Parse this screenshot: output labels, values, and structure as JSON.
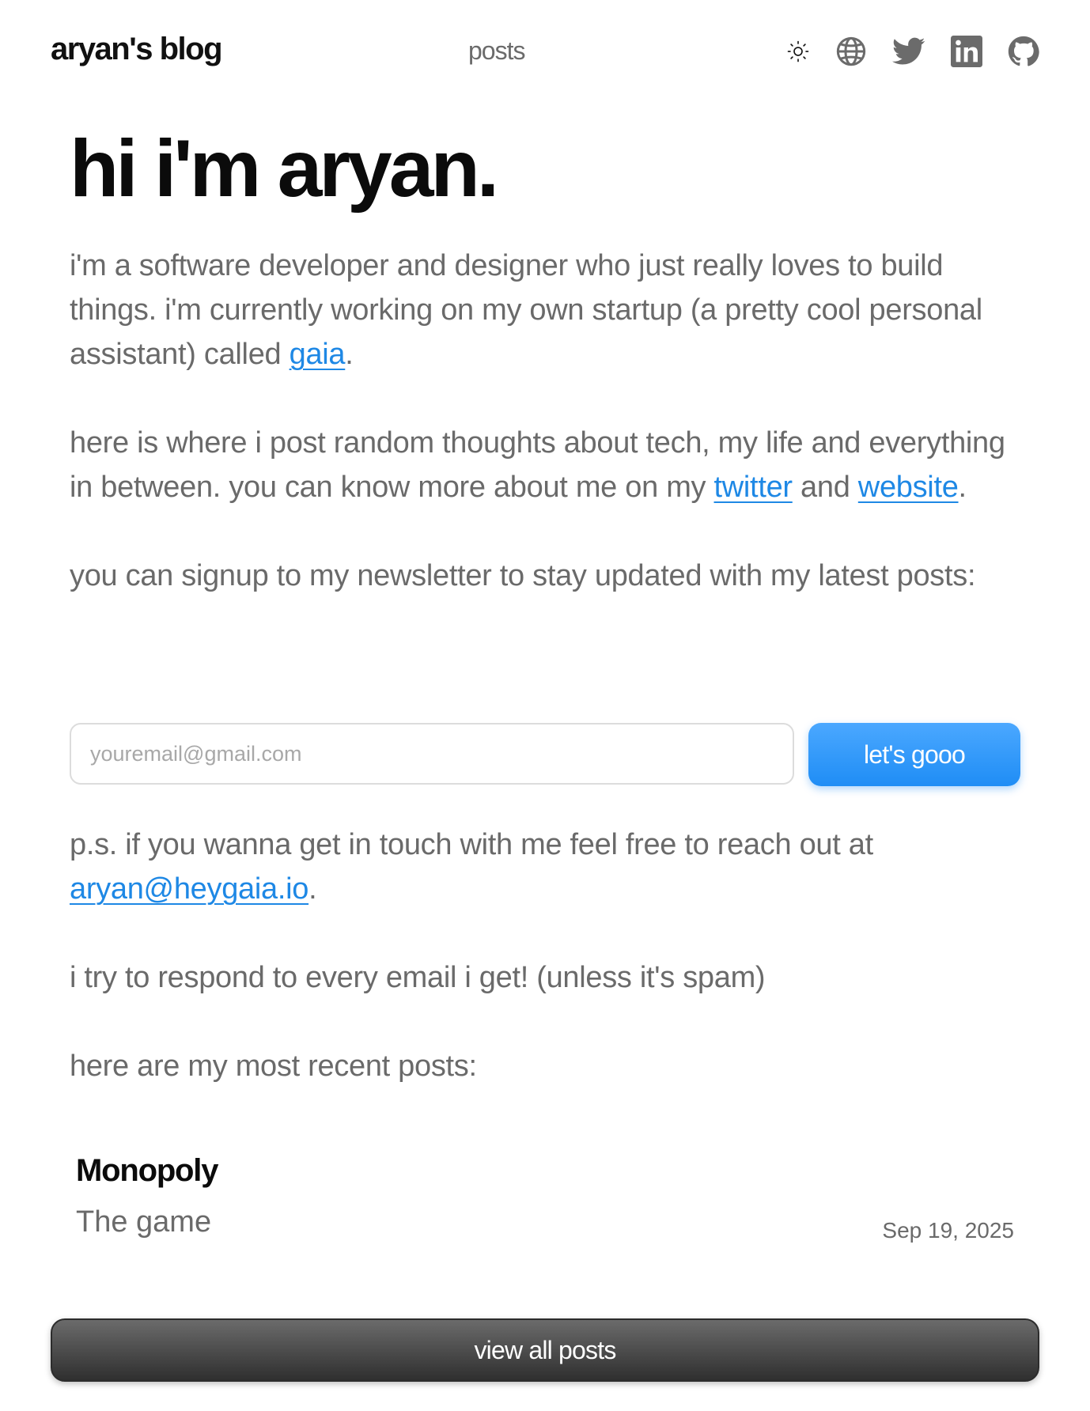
{
  "header": {
    "brand": "aryan's blog",
    "nav_posts": "posts",
    "icons": [
      "sun-icon",
      "globe-icon",
      "twitter-icon",
      "linkedin-icon",
      "github-icon"
    ]
  },
  "intro": {
    "hero": "hi i'm aryan.",
    "p1_before": "i'm a software developer and designer who just really loves to build things. i'm currently working on my own startup (a pretty cool personal assistant) called ",
    "p1_link": "gaia",
    "p1_after": ".",
    "p2_before": "here is where i post random thoughts about tech, my life and everything in between. you can know more about me on my ",
    "p2_link1": "twitter",
    "p2_mid": " and ",
    "p2_link2": "website",
    "p2_after": ".",
    "p3": "you can signup to my newsletter to stay updated with my latest posts:"
  },
  "newsletter": {
    "placeholder": "youremail@gmail.com",
    "value": "",
    "button": "let's gooo"
  },
  "contact": {
    "p4_before": "p.s. if you wanna get in touch with me feel free to reach out at ",
    "p4_link": "aryan@heygaia.io",
    "p4_after": ".",
    "p5": "i try to respond to every email i get! (unless it's spam)",
    "p6": "here are my most recent posts:"
  },
  "posts": [
    {
      "title": "Monopoly",
      "subtitle": "The game",
      "date": "Sep 19, 2025"
    }
  ],
  "view_all": "view all posts",
  "colors": {
    "link": "#1e88e5",
    "cta": "#2b95ff",
    "text_muted": "#6a6a6a"
  }
}
